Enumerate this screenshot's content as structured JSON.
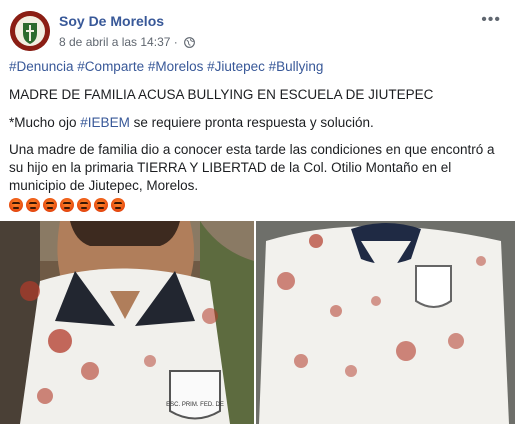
{
  "post": {
    "page_name": "Soy De Morelos",
    "timestamp": "8 de abril a las 14:37",
    "separator": "·",
    "more_label": "•••",
    "hashtags": "#Denuncia #Comparte #Morelos #Jiutepec #Bullying",
    "headline": "MADRE DE FAMILIA ACUSA BULLYING EN ESCUELA DE JIUTEPEC",
    "note_prefix": "*Mucho ojo ",
    "note_tag": "#IEBEM",
    "note_suffix": " se requiere pronta respuesta y solución.",
    "story": "Una madre de familia dio a conocer esta tarde las condiciones en que encontró a su hijo en la primaria TIERRA Y LIBERTAD de la Col. Otilio Montaño en el municipio de Jiutepec, Morelos.",
    "emoji_count": 7,
    "photos": [
      {
        "description_icon": "photo-child-shirt",
        "badge_text": "ESC. PRIM. FED. DE"
      },
      {
        "description_icon": "photo-shirt-flat"
      }
    ]
  },
  "colors": {
    "link": "#385898",
    "text": "#1c1e21",
    "meta": "#606770",
    "stain": "#b23a2a"
  }
}
